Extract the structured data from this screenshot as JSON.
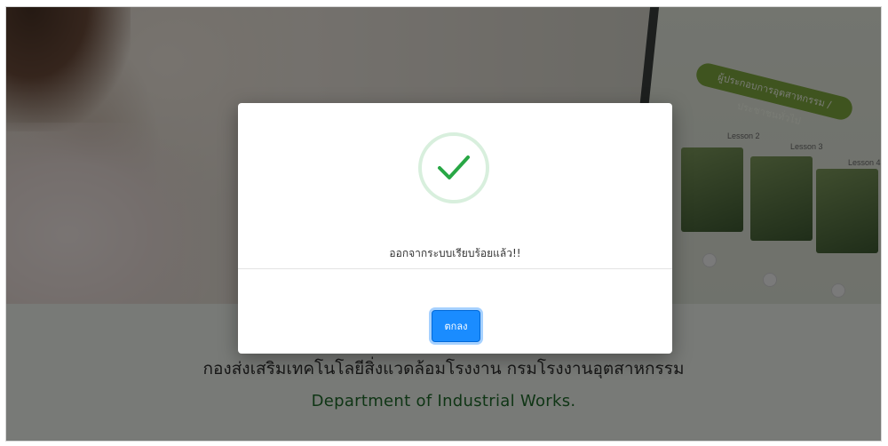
{
  "modal": {
    "message": "ออกจากระบบเรียบร้อยแล้ว!!",
    "ok_label": "ตกลง",
    "status_icon": "check-icon"
  },
  "page": {
    "thai_title": "กองส่งเสริมเทคโนโลยีสิ่งแวดล้อมโรงงาน กรมโรงงานอุตสาหกรรม",
    "english_title": "Department of Industrial Works."
  },
  "hero": {
    "banner_pill": "ผู้ประกอบการอุตสาหกรรม / ประชาชนทั่วไป",
    "lessons": [
      "Lesson 2",
      "Lesson 3",
      "Lesson 4"
    ]
  },
  "colors": {
    "accent": "#1a8cff",
    "success": "#28a745",
    "title_green": "#1f6b2a"
  }
}
